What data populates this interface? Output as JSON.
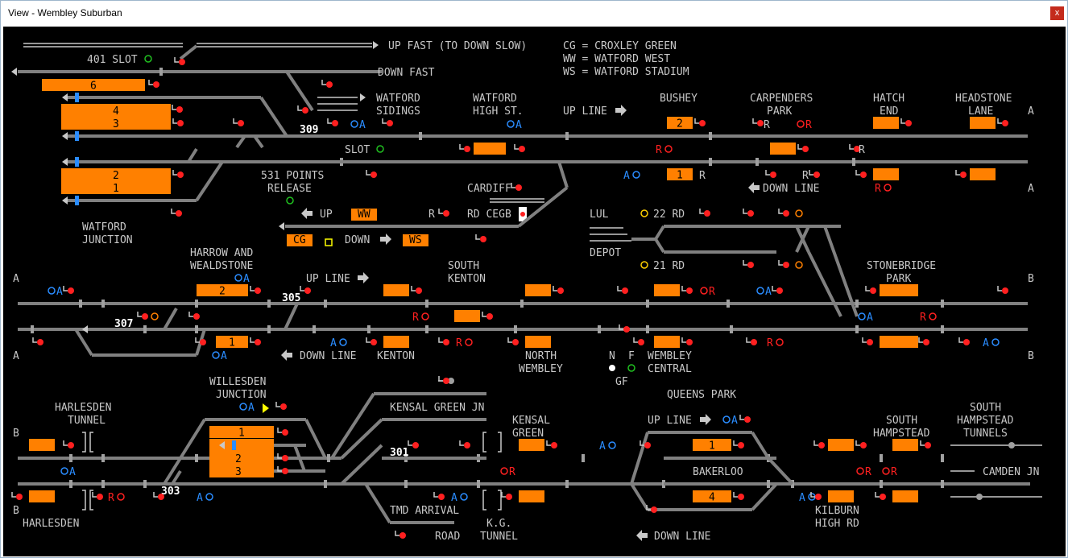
{
  "window": {
    "title": "View - Wembley Suburban",
    "close_label": "x"
  },
  "colors": {
    "background": "#000000",
    "track": "#808080",
    "berth": "#ff8000",
    "signal_red": "#ff2020",
    "aspect_blue": "#2a8cff",
    "aspect_red": "#ff2020",
    "white_text": "#ffffff"
  },
  "labels": {
    "up_fast": "UP FAST (TO DOWN SLOW)",
    "down_fast": "DOWN FAST",
    "slot_401": "401 SLOT",
    "legend": [
      "CG = CROXLEY GREEN",
      "WW = WATFORD WEST",
      "WS = WATFORD STADIUM"
    ],
    "watford_sidings": [
      "WATFORD",
      "SIDINGS"
    ],
    "watford_high_st": [
      "WATFORD",
      "HIGH ST."
    ],
    "up_line": "UP LINE",
    "bushey": "BUSHEY",
    "carpenders_park": [
      "CARPENDERS",
      "PARK"
    ],
    "hatch_end": [
      "HATCH",
      "END"
    ],
    "headstone_lane": [
      "HEADSTONE",
      "LANE"
    ],
    "slot": "SLOT",
    "points_release": [
      "531 POINTS",
      "RELEASE"
    ],
    "cardiff_rd_cegb": [
      "CARDIFF",
      "RD CEGB"
    ],
    "down_line": "DOWN LINE",
    "up": "UP",
    "down": "DOWN",
    "watford_junction": [
      "WATFORD",
      "JUNCTION"
    ],
    "lul_depot": [
      "LUL",
      "DEPOT"
    ],
    "rd22": "22 RD",
    "rd21": "21 RD",
    "harrow": [
      "HARROW AND",
      "WEALDSTONE"
    ],
    "south_kenton": [
      "SOUTH",
      "KENTON"
    ],
    "stonebridge_park": [
      "STONEBRIDGE",
      "PARK"
    ],
    "kenton": "KENTON",
    "north_wembley": [
      "NORTH",
      "WEMBLEY"
    ],
    "wembley_central": [
      "WEMBLEY",
      "CENTRAL"
    ],
    "nfgf": [
      "N",
      "F",
      "GF"
    ],
    "willesden_junction": [
      "WILLESDEN",
      "JUNCTION"
    ],
    "harlesden_tunnel": [
      "HARLESDEN",
      "TUNNEL"
    ],
    "harlesden": "HARLESDEN",
    "kensal_green_jn": "KENSAL GREEN JN",
    "kensal_green": [
      "KENSAL",
      "GREEN"
    ],
    "queens_park": "QUEENS PARK",
    "south_hampstead": [
      "SOUTH",
      "HAMPSTEAD"
    ],
    "south_hampstead_tunnels": [
      "SOUTH",
      "HAMPSTEAD",
      "TUNNELS"
    ],
    "camden_jn": "CAMDEN JN",
    "bakerloo": "BAKERLOO",
    "kilburn_high_rd": [
      "KILBURN",
      "HIGH RD"
    ],
    "tmd_arrival": "TMD ARRIVAL",
    "road": "ROAD",
    "kg_tunnel": [
      "K.G.",
      "TUNNEL"
    ],
    "boundary_letters": [
      "A",
      "B"
    ]
  },
  "signal_numbers": [
    "309",
    "305",
    "307",
    "301",
    "303"
  ],
  "aspect_labels": {
    "a": "A",
    "r": "R"
  },
  "platform_numbers": {
    "watford": [
      "6",
      "4",
      "3",
      "2",
      "1"
    ],
    "bushey": [
      "2",
      "1"
    ],
    "harrow": [
      "2",
      "1"
    ],
    "willesden": [
      "1",
      "2",
      "3"
    ],
    "queens_park": [
      "1",
      "4"
    ]
  },
  "boxes": {
    "cg": "CG",
    "ww": "WW",
    "ws": "WS"
  }
}
